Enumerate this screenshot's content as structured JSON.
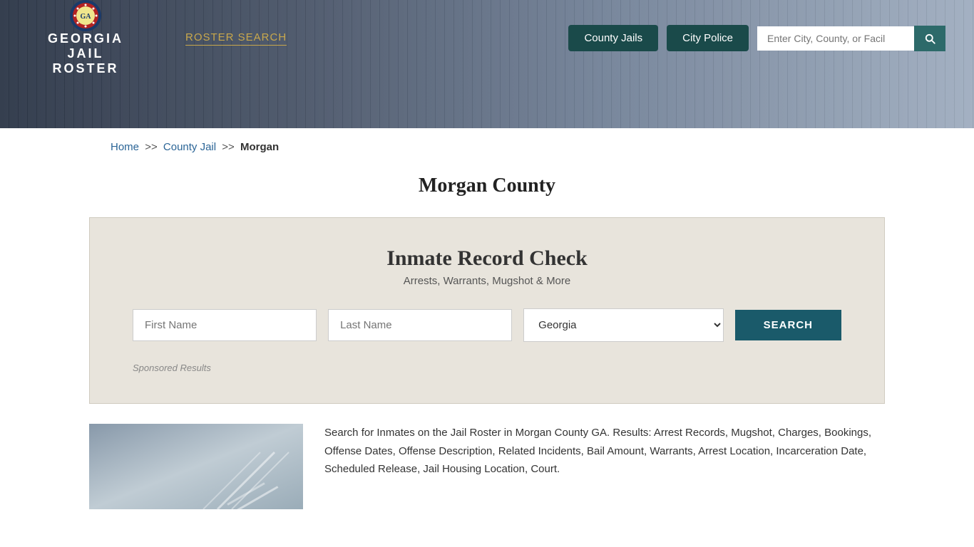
{
  "header": {
    "logo": {
      "line1": "GEORGIA",
      "line2": "JAIL",
      "line3": "ROSTER"
    },
    "nav": {
      "roster_search": "ROSTER SEARCH"
    },
    "buttons": {
      "county_jails": "County Jails",
      "city_police": "City Police"
    },
    "search": {
      "placeholder": "Enter City, County, or Facil"
    }
  },
  "breadcrumb": {
    "home": "Home",
    "county_jail": "County Jail",
    "sep1": ">>",
    "sep2": ">>",
    "current": "Morgan"
  },
  "page_title": "Morgan County",
  "record_check": {
    "title": "Inmate Record Check",
    "subtitle": "Arrests, Warrants, Mugshot & More",
    "first_name_placeholder": "First Name",
    "last_name_placeholder": "Last Name",
    "state_default": "Georgia",
    "search_button": "SEARCH",
    "sponsored_label": "Sponsored Results"
  },
  "bottom": {
    "description": "Search for Inmates on the Jail Roster in Morgan County GA. Results: Arrest Records, Mugshot, Charges, Bookings, Offense Dates, Offense Description, Related Incidents, Bail Amount, Warrants, Arrest Location, Incarceration Date, Scheduled Release, Jail Housing Location, Court."
  }
}
